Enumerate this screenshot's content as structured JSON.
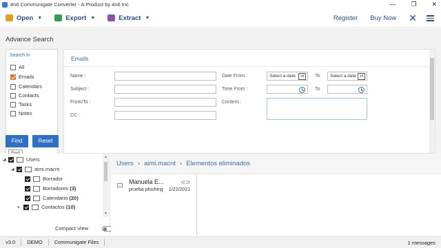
{
  "window": {
    "title": "4n6 Communigate Converter - A Product by 4n6 Inc",
    "controls": [
      "—",
      "❐",
      "✕"
    ]
  },
  "toolbar": {
    "open_label": "Open",
    "export_label": "Export",
    "extract_label": "Extract",
    "register_label": "Register",
    "buy_label": "Buy Now",
    "colors": {
      "open_icon": "#e0a020",
      "export_icon": "#2e9e4f",
      "extract_icon": "#8a4fb8",
      "accent": "#1f4e8c"
    }
  },
  "search": {
    "title": "Advance Search",
    "search_in_header": "Search in",
    "options": [
      {
        "label": "All",
        "checked": false
      },
      {
        "label": "Emails",
        "checked": true
      },
      {
        "label": "Calendars",
        "checked": false
      },
      {
        "label": "Contacts",
        "checked": false
      },
      {
        "label": "Tasks",
        "checked": false
      },
      {
        "label": "Notes",
        "checked": false
      }
    ],
    "form_tab": "Emails",
    "labels": {
      "name": "Name :",
      "subject": "Subject :",
      "from_to": "From/To :",
      "cc": "CC :",
      "date_from": "Date From :",
      "time_from": "Time From :",
      "content": "Content :",
      "to1": "To",
      "to2": "To"
    },
    "date_placeholder_1": "Select a date",
    "date_placeholder_2": "Select a date",
    "cal_day": "15",
    "find_label": "Find",
    "reset_label": "Reset",
    "tooltip": "Find"
  },
  "tree": {
    "items": [
      {
        "label": "Users",
        "count": ""
      },
      {
        "label": "aimi.macnt",
        "count": ""
      },
      {
        "label": "Borrador",
        "count": ""
      },
      {
        "label": "Borradores",
        "count": "(3)"
      },
      {
        "label": "Calendario",
        "count": "(20)"
      },
      {
        "label": "Contactos",
        "count": "(10)"
      }
    ],
    "compact_view": "Compact View"
  },
  "breadcrumb": [
    "Users",
    "aimi.macnt",
    "Elementos eliminados"
  ],
  "messages": [
    {
      "from": "Manuela E...",
      "subject": "prueba phishing",
      "date": "1/22/2021"
    }
  ],
  "status": {
    "version": "v3.0",
    "mode": "DEMO",
    "source": "Communigate Files",
    "count": "1 messages"
  }
}
